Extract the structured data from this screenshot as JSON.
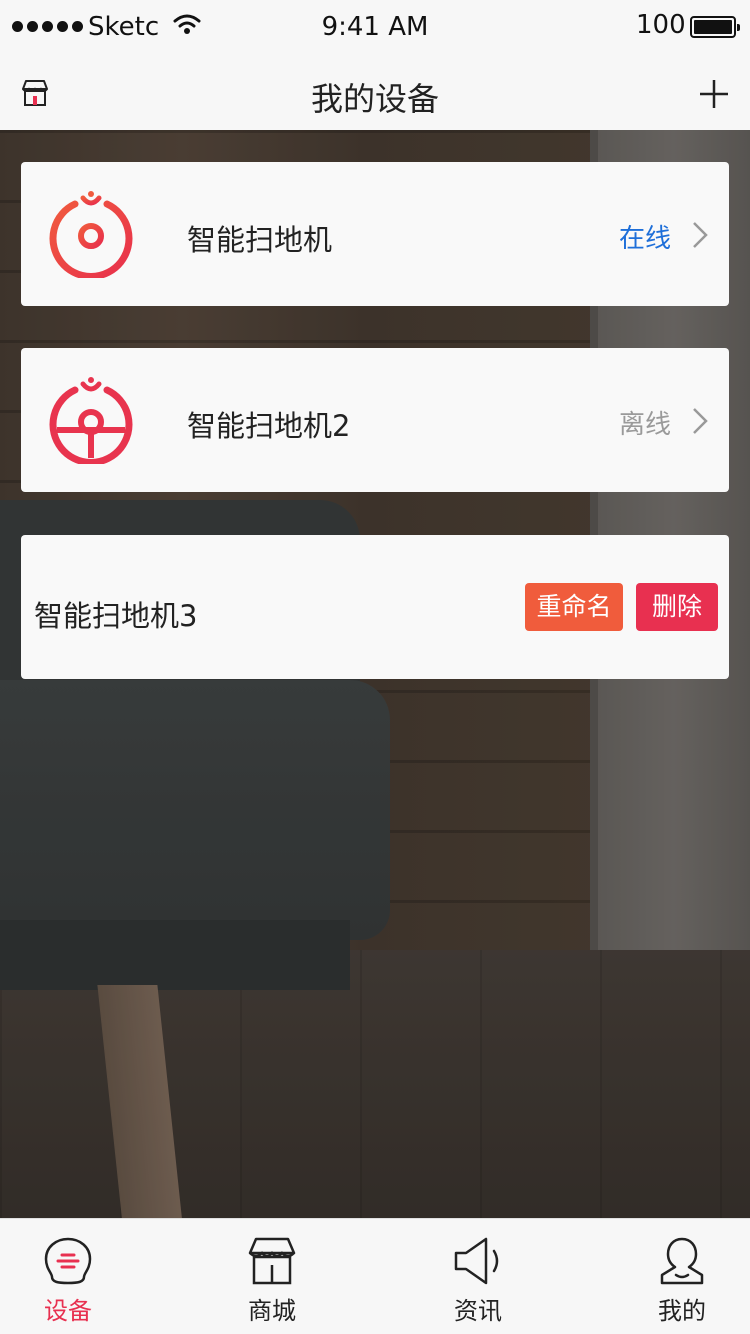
{
  "status_bar": {
    "carrier": "Sketc",
    "time": "9:41 AM",
    "battery": "100"
  },
  "nav": {
    "title": "我的设备",
    "left_icon": "store-icon",
    "right_icon": "add-icon"
  },
  "devices": [
    {
      "name": "智能扫地机",
      "status": "在线",
      "status_color": "#1e6fd9"
    },
    {
      "name": "智能扫地机2",
      "status": "离线",
      "status_color": "#9a9a9a"
    },
    {
      "name": "智能扫地机3",
      "actions": {
        "rename": "重命名",
        "delete": "删除"
      }
    }
  ],
  "tabs": [
    {
      "label": "设备",
      "icon": "device-icon",
      "active": true
    },
    {
      "label": "商城",
      "icon": "shop-icon",
      "active": false
    },
    {
      "label": "资讯",
      "icon": "speaker-icon",
      "active": false
    },
    {
      "label": "我的",
      "icon": "user-icon",
      "active": false
    }
  ],
  "colors": {
    "accent": "#e83050",
    "rename_button": "#f05c3c",
    "online": "#1e6fd9"
  }
}
